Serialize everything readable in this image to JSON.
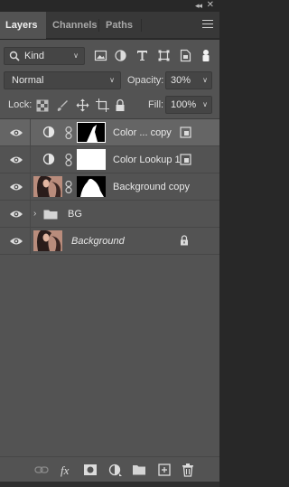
{
  "tabs": [
    {
      "label": "Layers",
      "active": true
    },
    {
      "label": "Channels",
      "active": false
    },
    {
      "label": "Paths",
      "active": false
    }
  ],
  "filter": {
    "kind_label": "Kind"
  },
  "blend": {
    "mode": "Normal",
    "opacity_label": "Opacity:",
    "opacity_value": "30%"
  },
  "lock": {
    "label": "Lock:",
    "fill_label": "Fill:",
    "fill_value": "100%"
  },
  "layers": [
    {
      "name": "Color ... copy",
      "type": "adjustment",
      "selected": true,
      "visible": true,
      "has_mask": true,
      "clipped": true
    },
    {
      "name": "Color Lookup 1",
      "type": "adjustment",
      "selected": false,
      "visible": true,
      "has_mask": true,
      "clipped": true
    },
    {
      "name": "Background copy",
      "type": "image",
      "selected": false,
      "visible": true,
      "has_mask": true
    },
    {
      "name": "BG",
      "type": "group",
      "selected": false,
      "visible": true
    },
    {
      "name": "Background",
      "type": "image",
      "selected": false,
      "visible": true,
      "locked": true,
      "italic": true
    }
  ],
  "colors": {
    "panel": "#535353",
    "selected_row": "#656565",
    "tabbar": "#383838",
    "text": "#e8e8e8"
  },
  "icons": {
    "filter_row": [
      "search-icon",
      "image-filter-icon",
      "adjustment-filter-icon",
      "type-filter-icon",
      "shape-filter-icon",
      "smart-object-filter-icon",
      "filter-toggle-icon"
    ],
    "lock_row": [
      "lock-transparent-icon",
      "lock-image-icon",
      "lock-position-icon",
      "lock-artboard-icon",
      "lock-all-icon"
    ],
    "bottom": [
      "link-layers-icon",
      "fx-icon",
      "add-mask-icon",
      "new-adjustment-icon",
      "new-group-icon",
      "new-layer-icon",
      "delete-icon"
    ]
  }
}
